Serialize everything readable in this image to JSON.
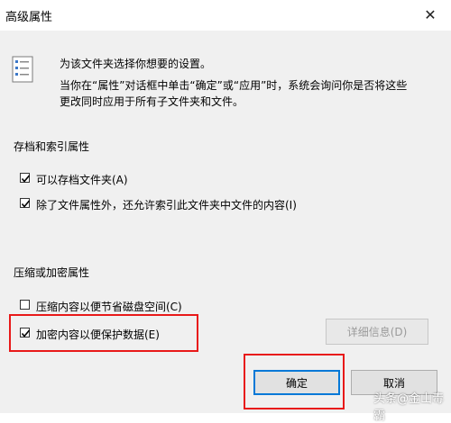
{
  "window": {
    "title": "高级属性",
    "close_icon": "close-icon"
  },
  "intro": {
    "line1": "为该文件夹选择你想要的设置。",
    "line2": "当你在“属性”对话框中单击“确定”或“应用”时，系统会询问你是否将这些",
    "line3": "更改同时应用于所有子文件夹和文件。"
  },
  "archive_section": {
    "heading": "存档和索引属性",
    "archive_label": "可以存档文件夹(A)",
    "archive_checked": true,
    "index_label": "除了文件属性外，还允许索引此文件夹中文件的内容(I)",
    "index_checked": true
  },
  "compress_section": {
    "heading": "压缩或加密属性",
    "compress_label": "压缩内容以便节省磁盘空间(C)",
    "compress_checked": false,
    "encrypt_label": "加密内容以便保护数据(E)",
    "encrypt_checked": true,
    "details_button": "详细信息(D)"
  },
  "buttons": {
    "ok": "确定",
    "cancel": "取消"
  },
  "watermark": {
    "text": "头条@金山毒霸"
  },
  "colors": {
    "highlight": "#e81919",
    "focus_border": "#0078d7"
  }
}
